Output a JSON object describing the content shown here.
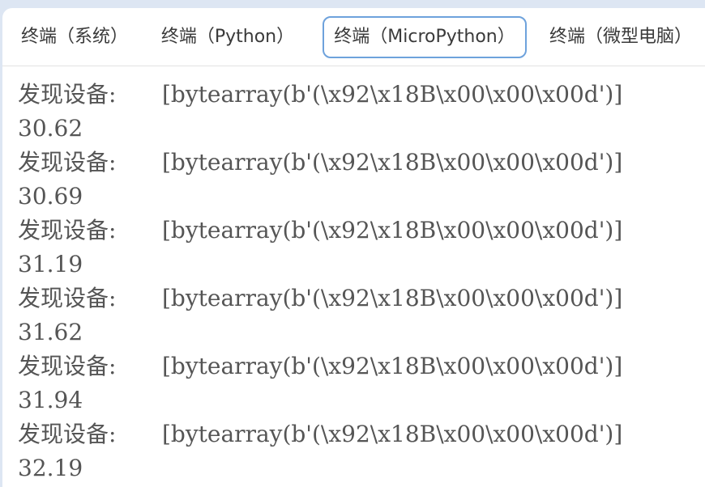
{
  "tabs": [
    {
      "label": "终端（系统）",
      "active": false
    },
    {
      "label": "终端（Python）",
      "active": false
    },
    {
      "label": "终端（MicroPython）",
      "active": true
    },
    {
      "label": "终端（微型电脑）",
      "active": false
    }
  ],
  "terminal": {
    "lines": [
      {
        "prefix": "发现设备:",
        "text": "[bytearray(b'(\\x92\\x18B\\x00\\x00\\x00d')]"
      },
      {
        "prefix": "",
        "text": "30.62"
      },
      {
        "prefix": "发现设备:",
        "text": "[bytearray(b'(\\x92\\x18B\\x00\\x00\\x00d')]"
      },
      {
        "prefix": "",
        "text": "30.69"
      },
      {
        "prefix": "发现设备:",
        "text": "[bytearray(b'(\\x92\\x18B\\x00\\x00\\x00d')]"
      },
      {
        "prefix": "",
        "text": "31.19"
      },
      {
        "prefix": "发现设备:",
        "text": "[bytearray(b'(\\x92\\x18B\\x00\\x00\\x00d')]"
      },
      {
        "prefix": "",
        "text": "31.62"
      },
      {
        "prefix": "发现设备:",
        "text": "[bytearray(b'(\\x92\\x18B\\x00\\x00\\x00d')]"
      },
      {
        "prefix": "",
        "text": "31.94"
      },
      {
        "prefix": "发现设备:",
        "text": "[bytearray(b'(\\x92\\x18B\\x00\\x00\\x00d')]"
      },
      {
        "prefix": "",
        "text": "32.19"
      }
    ]
  },
  "colors": {
    "accent": "#6ea2dc",
    "text": "#555555",
    "tab_text": "#3a3a3a",
    "frame": "#dde6f3"
  }
}
